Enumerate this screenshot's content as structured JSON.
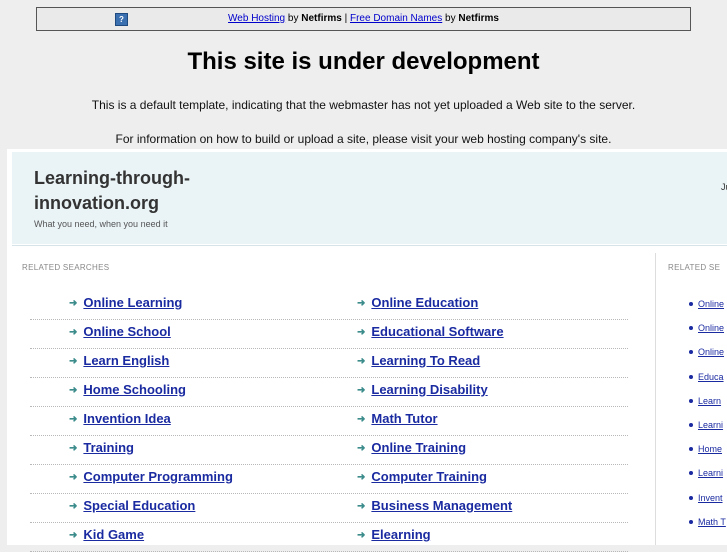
{
  "topbar": {
    "link1": "Web Hosting",
    "by1": " by ",
    "brand1": "Netfirms",
    "sep": " | ",
    "link2": "Free Domain Names",
    "by2": " by ",
    "brand2": "Netfirms"
  },
  "heading": "This site is under development",
  "para1": "This is a default template, indicating that the webmaster has not yet uploaded a Web site to the server.",
  "para2": "For information on how to build or upload a site, please visit your web hosting company's site.",
  "site": {
    "title": "Learning-through-innovation.org",
    "tagline": "What you need, when you need it",
    "date_fragment": "Ju"
  },
  "related_label": "RELATED SEARCHES",
  "related_label_side": "RELATED SE",
  "rows": [
    {
      "left": "Online Learning",
      "right": "Online Education"
    },
    {
      "left": "Online School",
      "right": "Educational Software"
    },
    {
      "left": "Learn English",
      "right": "Learning To Read"
    },
    {
      "left": "Home Schooling",
      "right": "Learning Disability"
    },
    {
      "left": "Invention Idea",
      "right": "Math Tutor"
    },
    {
      "left": "Training",
      "right": "Online Training"
    },
    {
      "left": "Computer Programming",
      "right": "Computer Training"
    },
    {
      "left": "Special Education",
      "right": "Business Management"
    },
    {
      "left": "Kid Game",
      "right": "Elearning"
    }
  ],
  "arrow_glyph": "➜",
  "side_items": [
    "Online",
    "Online",
    "Online",
    "Educa",
    "Learn",
    "Learni",
    "Home",
    "Learni",
    "Invent",
    "Math T"
  ]
}
